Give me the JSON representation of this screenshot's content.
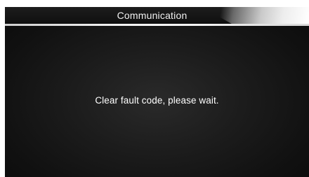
{
  "header": {
    "title": "Communication"
  },
  "main": {
    "message": "Clear fault code, please wait."
  },
  "colors": {
    "background": "#1a1a1a",
    "title_text": "#f2f2f2",
    "message_text": "#ffffff",
    "underline": "#ffffff"
  }
}
